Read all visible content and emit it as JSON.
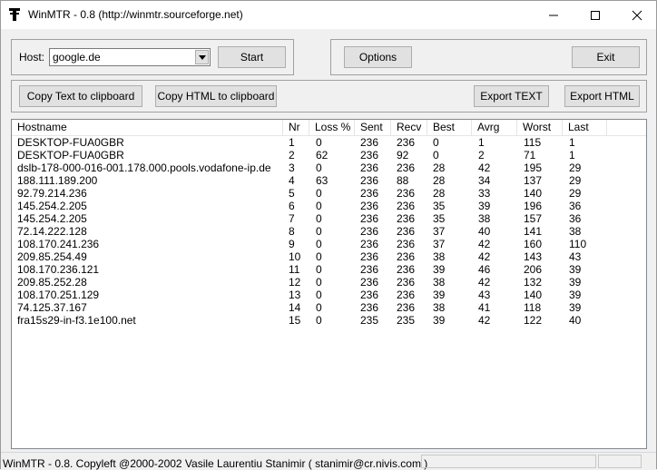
{
  "window": {
    "title": "WinMTR - 0.8 (http://winmtr.sourceforge.net)"
  },
  "controls": {
    "host_label": "Host:",
    "host_value": "google.de",
    "start_label": "Start",
    "options_label": "Options",
    "exit_label": "Exit",
    "copy_text_label": "Copy Text to clipboard",
    "copy_html_label": "Copy HTML to clipboard",
    "export_text_label": "Export TEXT",
    "export_html_label": "Export HTML"
  },
  "table": {
    "columns": [
      "Hostname",
      "Nr",
      "Loss %",
      "Sent",
      "Recv",
      "Best",
      "Avrg",
      "Worst",
      "Last"
    ],
    "rows": [
      [
        "DESKTOP-FUA0GBR",
        "1",
        "0",
        "236",
        "236",
        "0",
        "1",
        "115",
        "1"
      ],
      [
        "DESKTOP-FUA0GBR",
        "2",
        "62",
        "236",
        "92",
        "0",
        "2",
        "71",
        "1"
      ],
      [
        "dslb-178-000-016-001.178.000.pools.vodafone-ip.de",
        "3",
        "0",
        "236",
        "236",
        "28",
        "42",
        "195",
        "29"
      ],
      [
        "188.111.189.200",
        "4",
        "63",
        "236",
        "88",
        "28",
        "34",
        "137",
        "29"
      ],
      [
        "92.79.214.236",
        "5",
        "0",
        "236",
        "236",
        "28",
        "33",
        "140",
        "29"
      ],
      [
        "145.254.2.205",
        "6",
        "0",
        "236",
        "236",
        "35",
        "39",
        "196",
        "36"
      ],
      [
        "145.254.2.205",
        "7",
        "0",
        "236",
        "236",
        "35",
        "38",
        "157",
        "36"
      ],
      [
        "72.14.222.128",
        "8",
        "0",
        "236",
        "236",
        "37",
        "40",
        "141",
        "38"
      ],
      [
        "108.170.241.236",
        "9",
        "0",
        "236",
        "236",
        "37",
        "42",
        "160",
        "110"
      ],
      [
        "209.85.254.49",
        "10",
        "0",
        "236",
        "236",
        "38",
        "42",
        "143",
        "43"
      ],
      [
        "108.170.236.121",
        "11",
        "0",
        "236",
        "236",
        "39",
        "46",
        "206",
        "39"
      ],
      [
        "209.85.252.28",
        "12",
        "0",
        "236",
        "236",
        "38",
        "42",
        "132",
        "39"
      ],
      [
        "108.170.251.129",
        "13",
        "0",
        "236",
        "236",
        "39",
        "43",
        "140",
        "39"
      ],
      [
        "74.125.37.167",
        "14",
        "0",
        "236",
        "236",
        "38",
        "41",
        "118",
        "39"
      ],
      [
        "fra15s29-in-f3.1e100.net",
        "15",
        "0",
        "235",
        "235",
        "39",
        "42",
        "122",
        "40"
      ]
    ]
  },
  "statusbar": {
    "text": "WinMTR - 0.8. Copyleft @2000-2002 Vasile Laurentiu Stanimir  ( stanimir@cr.nivis.com )"
  },
  "icons": {
    "app": "winmtr-icon",
    "minimize": "minimize-icon",
    "maximize": "maximize-icon",
    "close": "close-icon",
    "dropdown": "chevron-down-icon"
  }
}
